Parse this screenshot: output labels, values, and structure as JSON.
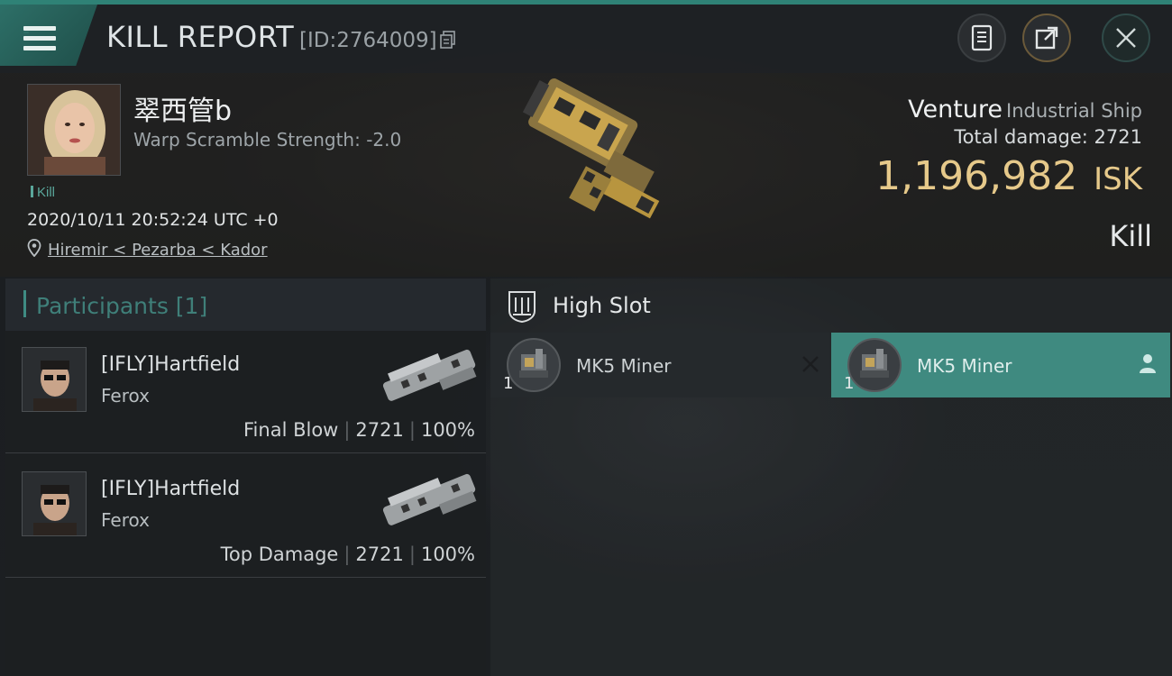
{
  "header": {
    "title": "KILL REPORT",
    "report_id": "[ID:2764009]"
  },
  "victim": {
    "name": "翠西管b",
    "warp_scramble": "Warp Scramble Strength: -2.0",
    "tag": "Kill",
    "datetime": "2020/10/11 20:52:24 UTC +0",
    "location": "Hiremir < Pezarba < Kador"
  },
  "loss": {
    "ship_name": "Venture",
    "ship_class": "Industrial Ship",
    "total_damage": "Total damage:  2721",
    "isk_value": "1,196,982",
    "isk_unit": "ISK",
    "result": "Kill"
  },
  "participants": {
    "title": "Participants [1]",
    "rows": [
      {
        "name": "[IFLY]Hartfield",
        "ship": "Ferox",
        "role": "Final Blow",
        "damage": "2721",
        "percent": "100%"
      },
      {
        "name": "[IFLY]Hartfield",
        "ship": "Ferox",
        "role": "Top Damage",
        "damage": "2721",
        "percent": "100%"
      }
    ]
  },
  "modules": {
    "slot_title": "High Slot",
    "items": [
      {
        "name": "MK5 Miner",
        "qty": "1",
        "status": "destroyed"
      },
      {
        "name": "MK5 Miner",
        "qty": "1",
        "status": "dropped"
      }
    ]
  },
  "colors": {
    "accent": "#3f8a80",
    "isk": "#e6c98a"
  }
}
